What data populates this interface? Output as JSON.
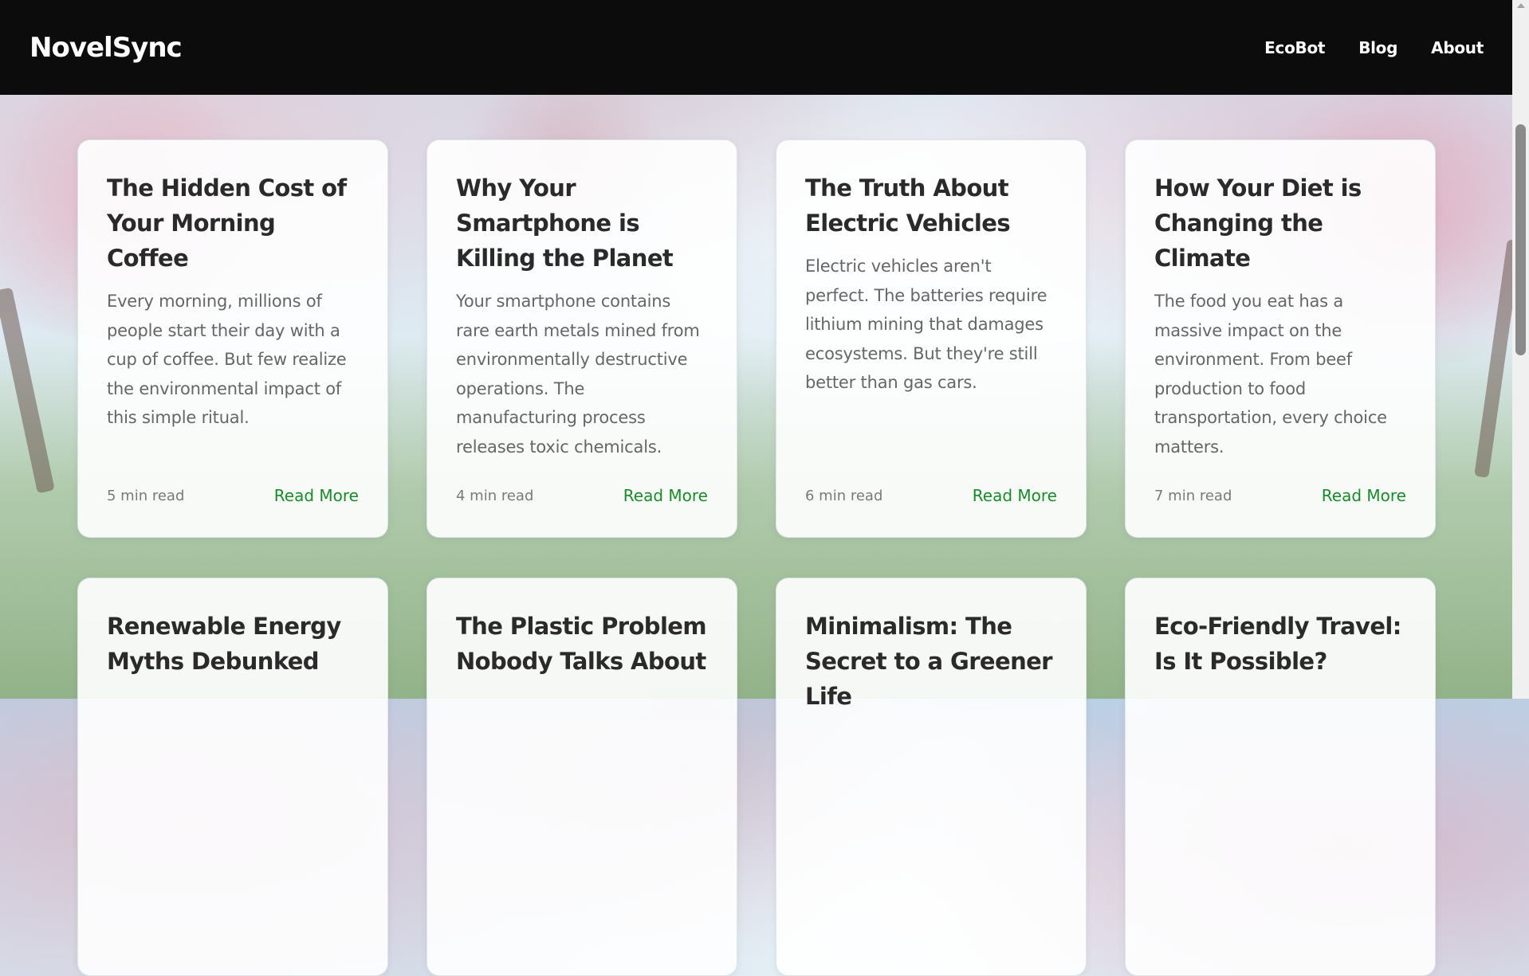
{
  "brand": "NovelSync",
  "nav": {
    "items": [
      "EcoBot",
      "Blog",
      "About"
    ]
  },
  "colors": {
    "navbar": "#0c0c0c",
    "accent": "#1a8a2a",
    "title": "#2a2a2a",
    "text": "#666666"
  },
  "posts": [
    {
      "title": "The Hidden Cost of Your Morning Coffee",
      "excerpt": "Every morning, millions of people start their day with a cup of coffee. But few realize the environmental impact of this simple ritual.",
      "read_time": "5 min read",
      "cta": "Read More"
    },
    {
      "title": "Why Your Smartphone is Killing the Planet",
      "excerpt": "Your smartphone contains rare earth metals mined from environmentally destructive operations. The manufacturing process releases toxic chemicals.",
      "read_time": "4 min read",
      "cta": "Read More"
    },
    {
      "title": "The Truth About Electric Vehicles",
      "excerpt": "Electric vehicles aren't perfect. The batteries require lithium mining that damages ecosystems. But they're still better than gas cars.",
      "read_time": "6 min read",
      "cta": "Read More"
    },
    {
      "title": "How Your Diet is Changing the Climate",
      "excerpt": "The food you eat has a massive impact on the environment. From beef production to food transportation, every choice matters.",
      "read_time": "7 min read",
      "cta": "Read More"
    },
    {
      "title": "Renewable Energy Myths Debunked"
    },
    {
      "title": "The Plastic Problem Nobody Talks About"
    },
    {
      "title": "Minimalism: The Secret to a Greener Life"
    },
    {
      "title": "Eco-Friendly Travel: Is It Possible?"
    }
  ]
}
